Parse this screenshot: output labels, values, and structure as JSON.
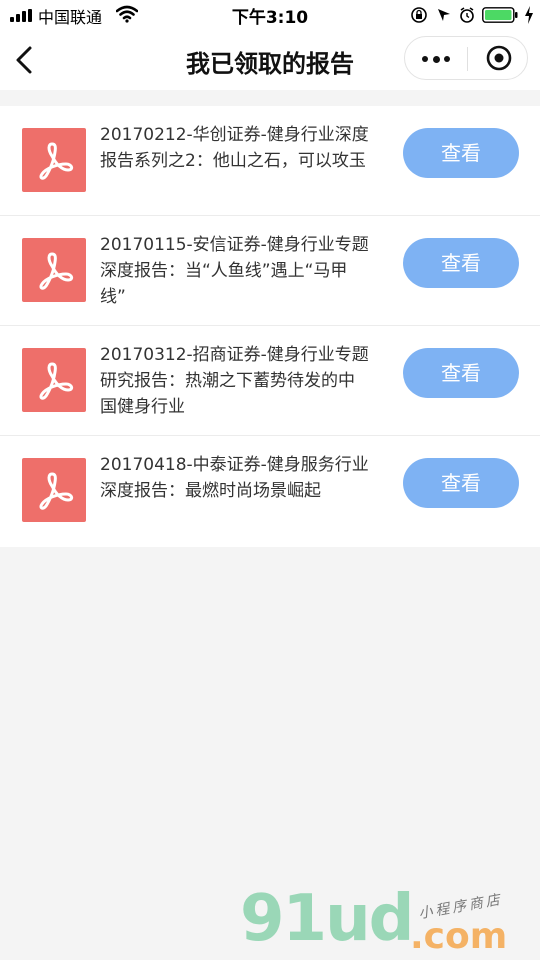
{
  "status_bar": {
    "carrier": "中国联通",
    "time": "下午3:10"
  },
  "nav": {
    "title": "我已领取的报告"
  },
  "reports": [
    {
      "title": "20170212-华创证券-健身行业深度报告系列之2：他山之石，可以攻玉",
      "button": "查看"
    },
    {
      "title": "20170115-安信证券-健身行业专题深度报告：当“人鱼线”遇上“马甲线”",
      "button": "查看"
    },
    {
      "title": "20170312-招商证券-健身行业专题研究报告：热潮之下蓄势待发的中国健身行业",
      "button": "查看"
    },
    {
      "title": "20170418-中泰证券-健身服务行业深度报告：最燃时尚场景崛起",
      "button": "查看"
    }
  ],
  "watermark": {
    "main": "91ud",
    "suffix": ".com",
    "sub": "小程序商店"
  },
  "colors": {
    "pdf_icon": "#ee6f6a",
    "view_button": "#7eb2f3",
    "battery": "#4cd964",
    "background": "#f4f4f4"
  }
}
